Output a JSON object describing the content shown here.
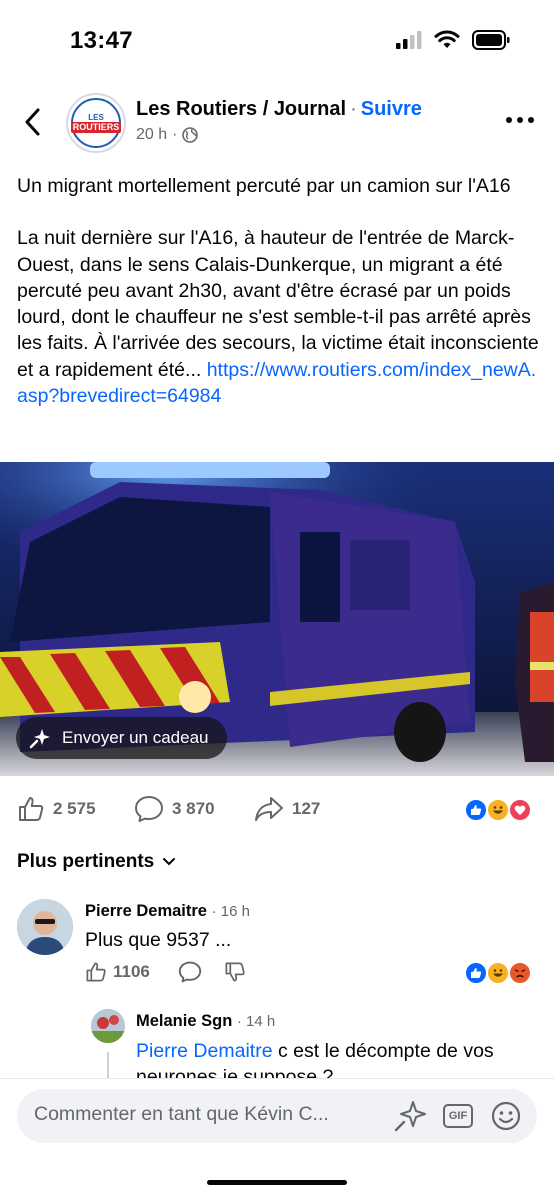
{
  "status_bar": {
    "time": "13:47"
  },
  "header": {
    "page_name": "Les Routiers / Journal",
    "separator": "·",
    "follow_label": "Suivre",
    "time_ago": "20 h",
    "meta_sep": "·",
    "logo_top": "LES",
    "logo_main": "ROUTIERS"
  },
  "post": {
    "title": "Un migrant mortellement percuté par un camion sur l'A16",
    "body": "La nuit dernière sur l'A16, à hauteur de l'entrée de Marck-Ouest, dans le sens Calais-Dunkerque, un migrant a été percuté peu avant 2h30, avant d'être écrasé par un poids lourd, dont le chauffeur ne s'est semble-t-il pas arrêté après les faits. À l'arrivée des secours, la victime était inconsciente et a rapidement été... ",
    "link": "https://www.routiers.com/index_newA.asp?brevedirect=64984",
    "gift_label": "Envoyer un cadeau",
    "likes": "2 575",
    "comments": "3 870",
    "shares": "127"
  },
  "sort": {
    "label": "Plus pertinents"
  },
  "comments": [
    {
      "author": "Pierre Demaitre",
      "time": "· 16 h",
      "text": "Plus que 9537 ...",
      "likes": "1106"
    },
    {
      "author": "Melanie Sgn",
      "time": "· 14 h",
      "mention": "Pierre Demaitre",
      "text": " c est le décompte de vos",
      "text_cont": "neurones je suppose ?"
    }
  ],
  "composer": {
    "placeholder": "Commenter en tant que Kévin C...",
    "gif_label": "GIF"
  },
  "colors": {
    "accent": "#0866ff",
    "muted": "#65676b"
  }
}
